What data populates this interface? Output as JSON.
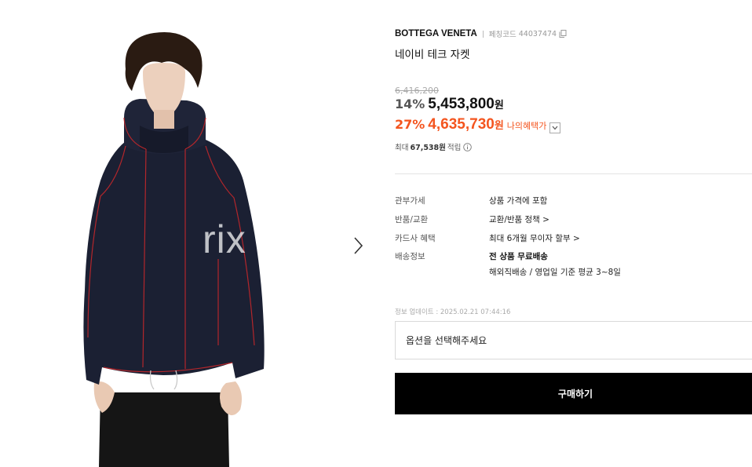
{
  "product": {
    "brand": "BOTTEGA VENETA",
    "code_label": "페칭코드",
    "code_value": "44037474",
    "name": "네이비 테크 자켓"
  },
  "pricing": {
    "original_price": "6,416,200",
    "discount1": "14%",
    "price1": "5,453,800",
    "currency": "원",
    "discount2": "27%",
    "price2": "4,635,730",
    "my_benefit_label": "나의혜택가",
    "points_prefix": "최대",
    "points_value": "67,538원",
    "points_suffix": "적립"
  },
  "specs": [
    {
      "label": "관부가세",
      "value": "상품 가격에 포함"
    },
    {
      "label": "반품/교환",
      "value": "교환/반품 정책 >"
    },
    {
      "label": "카드사 혜택",
      "value": "최대 6개월 무이자 할부 >"
    },
    {
      "label": "배송정보",
      "value": "전 상품 무료배송",
      "sub_value": "해외직배송 / 영업일 기준 평균 3~8일"
    }
  ],
  "update_text": "정보 업데이트 : 2025.02.21 07:44:16",
  "option_placeholder": "옵션을 선택해주세요",
  "buy_label": "구매하기",
  "gallery": {
    "watermark": "rix",
    "next_icon": "chevron-right-icon"
  },
  "colors": {
    "accent": "#f4551f",
    "button_bg": "#000000",
    "jacket": "#1b2033",
    "stitch": "#b3262b"
  }
}
